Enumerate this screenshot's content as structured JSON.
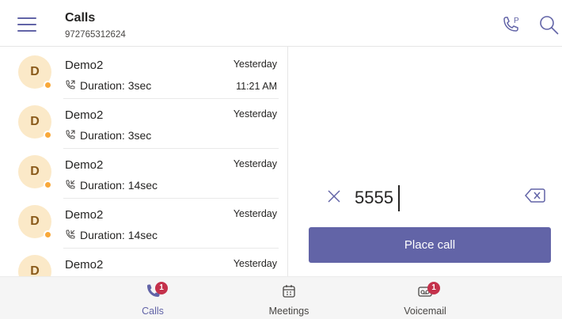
{
  "header": {
    "title": "Calls",
    "subtitle": "972765312624",
    "menu_icon": "hamburger-menu-icon",
    "park_icon": "call-park-icon",
    "search_icon": "search-icon"
  },
  "calls": [
    {
      "avatar": "D",
      "name": "Demo2",
      "duration": "Duration: 3sec",
      "date": "Yesterday",
      "time": "11:21 AM"
    },
    {
      "avatar": "D",
      "name": "Demo2",
      "duration": "Duration: 3sec",
      "date": "Yesterday",
      "time": ""
    },
    {
      "avatar": "D",
      "name": "Demo2",
      "duration": "Duration: 14sec",
      "date": "Yesterday",
      "time": ""
    },
    {
      "avatar": "D",
      "name": "Demo2",
      "duration": "Duration: 14sec",
      "date": "Yesterday",
      "time": ""
    },
    {
      "avatar": "D",
      "name": "Demo2",
      "duration": "",
      "date": "Yesterday",
      "time": ""
    }
  ],
  "dialer": {
    "value": "5555",
    "place_call_label": "Place call"
  },
  "tabs": [
    {
      "label": "Calls",
      "icon": "phone-icon",
      "badge": "1",
      "active": true
    },
    {
      "label": "Meetings",
      "icon": "calendar-icon",
      "badge": "",
      "active": false
    },
    {
      "label": "Voicemail",
      "icon": "voicemail-icon",
      "badge": "1",
      "active": false
    }
  ],
  "colors": {
    "accent": "#6264a7",
    "badge": "#c4314b",
    "presence_away": "#f8a83a",
    "avatar_bg": "#fbe9c8"
  }
}
